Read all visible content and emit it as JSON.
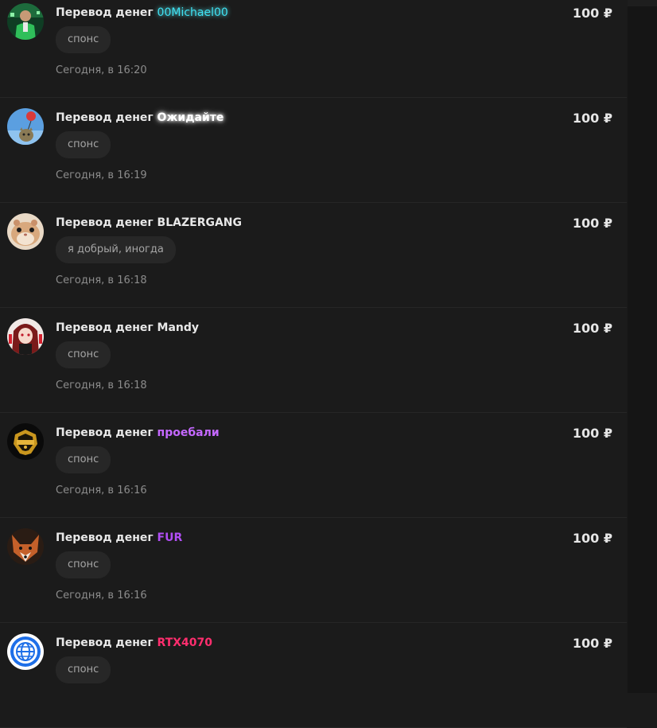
{
  "currency": "₽",
  "transfers": [
    {
      "title_prefix": "Перевод денег",
      "sender": "00Michael00",
      "sender_color": "#3fe2f2",
      "amount": "100 ₽",
      "message": "спонс",
      "time": "Сегодня, в 16:20",
      "avatar_icon": "green-suit-avatar-icon"
    },
    {
      "title_prefix": "Перевод денег",
      "sender": "Ожидайте",
      "sender_color": "#ffffff",
      "amount": "100 ₽",
      "message": "спонс",
      "time": "Сегодня, в 16:19",
      "avatar_icon": "cat-balloon-avatar-icon"
    },
    {
      "title_prefix": "Перевод денег",
      "sender": "BLAZERGANG",
      "sender_color": "#e8e8e8",
      "amount": "100 ₽",
      "message": "я добрый, иногда",
      "time": "Сегодня, в 16:18",
      "avatar_icon": "hamster-avatar-icon"
    },
    {
      "title_prefix": "Перевод денег",
      "sender": "Mandy",
      "sender_color": "#e8e8e8",
      "amount": "100 ₽",
      "message": "спонс",
      "time": "Сегодня, в 16:18",
      "avatar_icon": "anime-girl-avatar-icon"
    },
    {
      "title_prefix": "Перевод денег",
      "sender": "проебали",
      "sender_color": "#c468ff",
      "amount": "100 ₽",
      "message": "спонс",
      "time": "Сегодня, в 16:16",
      "avatar_icon": "gold-emblem-avatar-icon"
    },
    {
      "title_prefix": "Перевод денег",
      "sender": "FUR",
      "sender_color": "#b14ef5",
      "amount": "100 ₽",
      "message": "спонс",
      "time": "Сегодня, в 16:16",
      "avatar_icon": "fox-avatar-icon"
    },
    {
      "title_prefix": "Перевод денег",
      "sender": "RTX4070",
      "sender_color": "#ff2e6e",
      "amount": "100 ₽",
      "message": "спонс",
      "time": "",
      "avatar_icon": "globe-avatar-icon"
    }
  ]
}
